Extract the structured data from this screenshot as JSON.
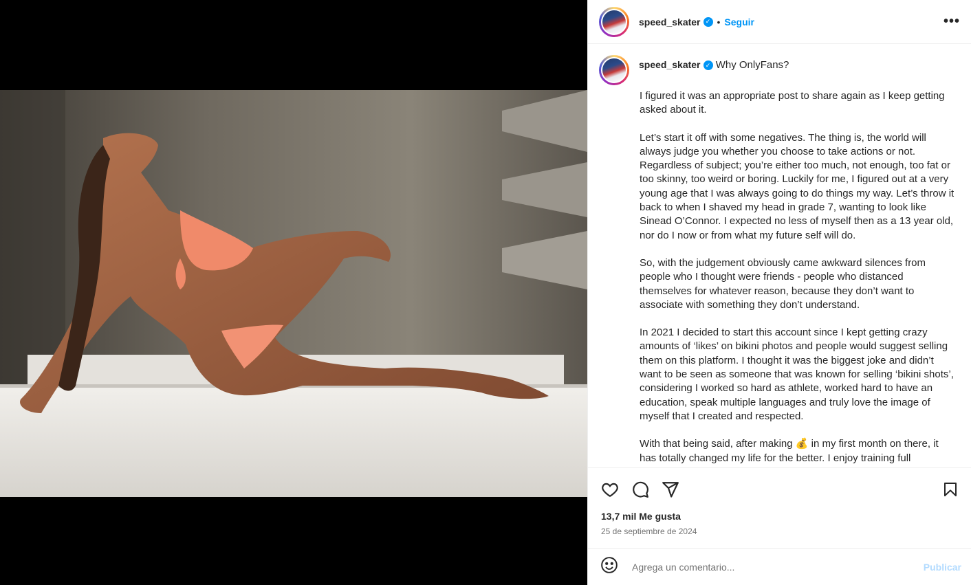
{
  "post": {
    "username": "speed_skater",
    "follow_label": "Seguir",
    "separator": "•",
    "more_label": "•••",
    "caption_title": "Why OnlyFans?",
    "caption_paragraphs": [
      "I figured it was an appropriate post to share again as I keep getting asked about it.",
      "Let’s start it off with some negatives. The thing is, the world will always judge you whether you choose to take actions or not. Regardless of subject; you’re either too much, not enough, too fat or too skinny, too weird or boring. Luckily for me, I figured out at a very young age that I was always going to do things my way. Let’s throw it back to when I shaved my head in grade 7, wanting to look like Sinead O’Connor. I expected no less of myself then as a 13 year old, nor do I now or from what my future self will do.",
      "So, with the judgement obviously came awkward silences from people who I thought were friends - people who distanced themselves for whatever reason, because they don’t want to associate with something they don’t understand.",
      "In 2021 I decided to start this account since I kept getting crazy amounts of ‘likes’ on bikini photos and people would suggest selling them on this platform. I thought it was the biggest joke and didn’t want to be seen as someone that was known for selling ‘bikini shots’, considering I worked so hard as athlete, worked hard to have an education, speak multiple languages and truly love the image of myself that I created and respected.",
      "With that being said, after making 💰 in my first month on there, it has totally changed my life for the better. I enjoy training full"
    ],
    "likes": "13,7 mil Me gusta",
    "date": "25 de septiembre de 2024",
    "comment_placeholder": "Agrega un comentario...",
    "publish_label": "Publicar"
  },
  "icons": [
    "heart-icon",
    "comment-icon",
    "share-icon",
    "bookmark-icon",
    "emoji-icon",
    "verified-icon",
    "more-icon"
  ],
  "colors": {
    "accent": "#0095f6",
    "publish_disabled": "#b3dbff",
    "text": "#262626",
    "muted": "#737373",
    "border": "#efefef"
  }
}
